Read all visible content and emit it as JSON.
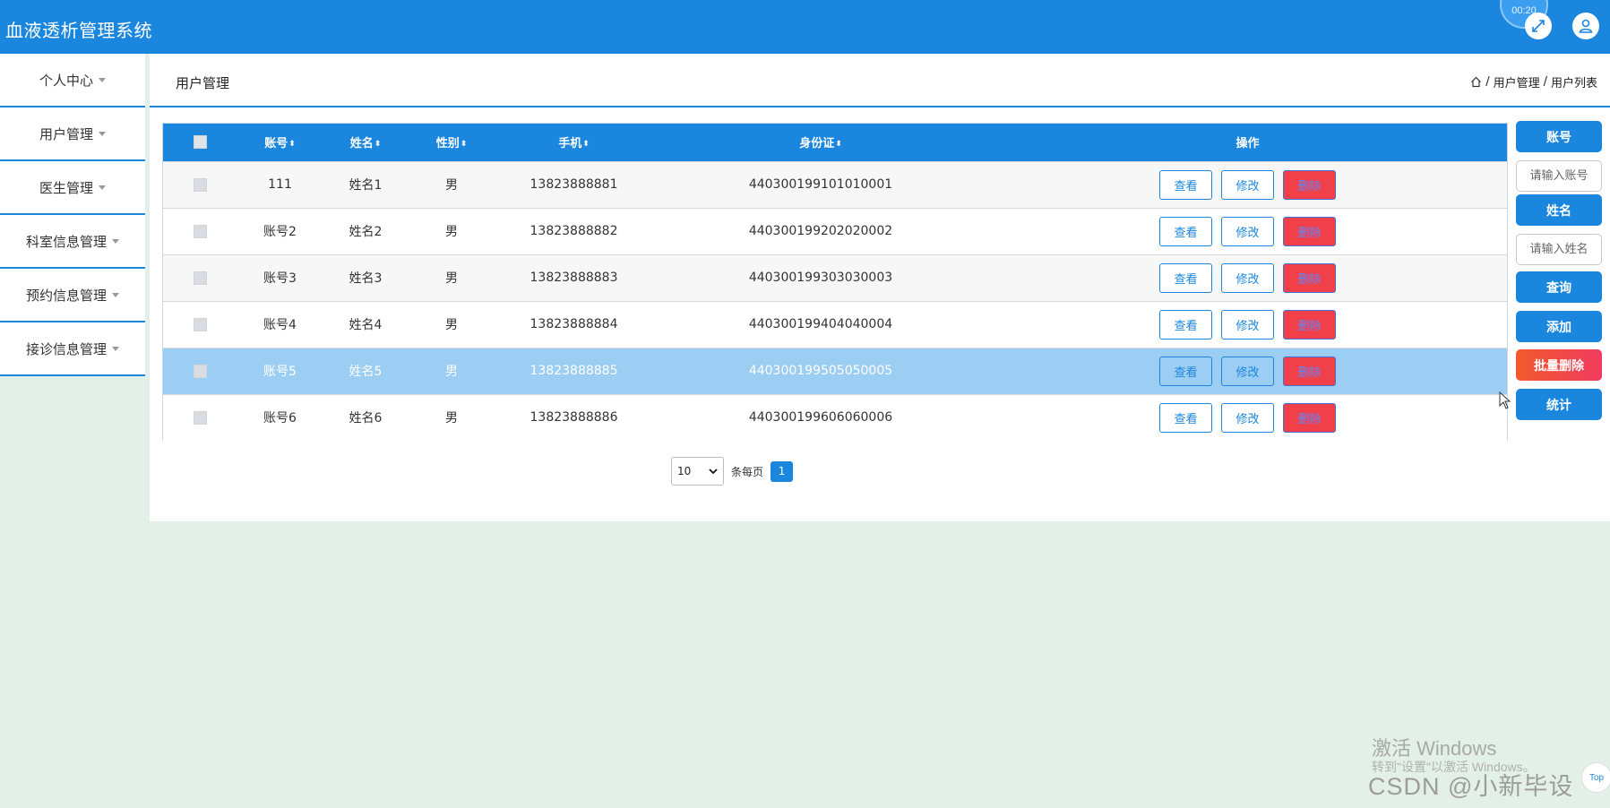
{
  "app": {
    "title": "血液透析管理系统",
    "timer": "00:20"
  },
  "sidebar": {
    "items": [
      {
        "label": "个人中心"
      },
      {
        "label": "用户管理"
      },
      {
        "label": "医生管理"
      },
      {
        "label": "科室信息管理"
      },
      {
        "label": "预约信息管理"
      },
      {
        "label": "接诊信息管理"
      }
    ]
  },
  "page": {
    "title": "用户管理",
    "breadcrumb": [
      "用户管理",
      "用户列表"
    ]
  },
  "table": {
    "columns": [
      "账号",
      "姓名",
      "性别",
      "手机",
      "身份证",
      "操作"
    ],
    "rows": [
      {
        "account": "111",
        "name": "姓名1",
        "gender": "男",
        "phone": "13823888881",
        "id_card": "440300199101010001"
      },
      {
        "account": "账号2",
        "name": "姓名2",
        "gender": "男",
        "phone": "13823888882",
        "id_card": "440300199202020002"
      },
      {
        "account": "账号3",
        "name": "姓名3",
        "gender": "男",
        "phone": "13823888883",
        "id_card": "440300199303030003"
      },
      {
        "account": "账号4",
        "name": "姓名4",
        "gender": "男",
        "phone": "13823888884",
        "id_card": "440300199404040004"
      },
      {
        "account": "账号5",
        "name": "姓名5",
        "gender": "男",
        "phone": "13823888885",
        "id_card": "440300199505050005"
      },
      {
        "account": "账号6",
        "name": "姓名6",
        "gender": "男",
        "phone": "13823888886",
        "id_card": "440300199606060006"
      }
    ],
    "row_actions": {
      "view": "查看",
      "edit": "修改",
      "delete": "删除"
    }
  },
  "pagination": {
    "page_size": "10",
    "per_page_label": "条每页",
    "current_page": "1"
  },
  "search": {
    "account_label": "账号",
    "account_placeholder": "请输入账号",
    "name_label": "姓名",
    "name_placeholder": "请输入姓名",
    "query": "查询",
    "add": "添加",
    "batch_delete": "批量删除",
    "stats": "统计"
  },
  "watermark": {
    "activate": "激活 Windows",
    "activate_hint": "转到\"设置\"以激活 Windows。",
    "csdn": "CSDN @小新毕设",
    "top": "Top"
  },
  "colors": {
    "primary": "#1a86de",
    "danger": "#f2404a",
    "selected_row": "#9ccdf2",
    "background": "#e3f0e8"
  }
}
